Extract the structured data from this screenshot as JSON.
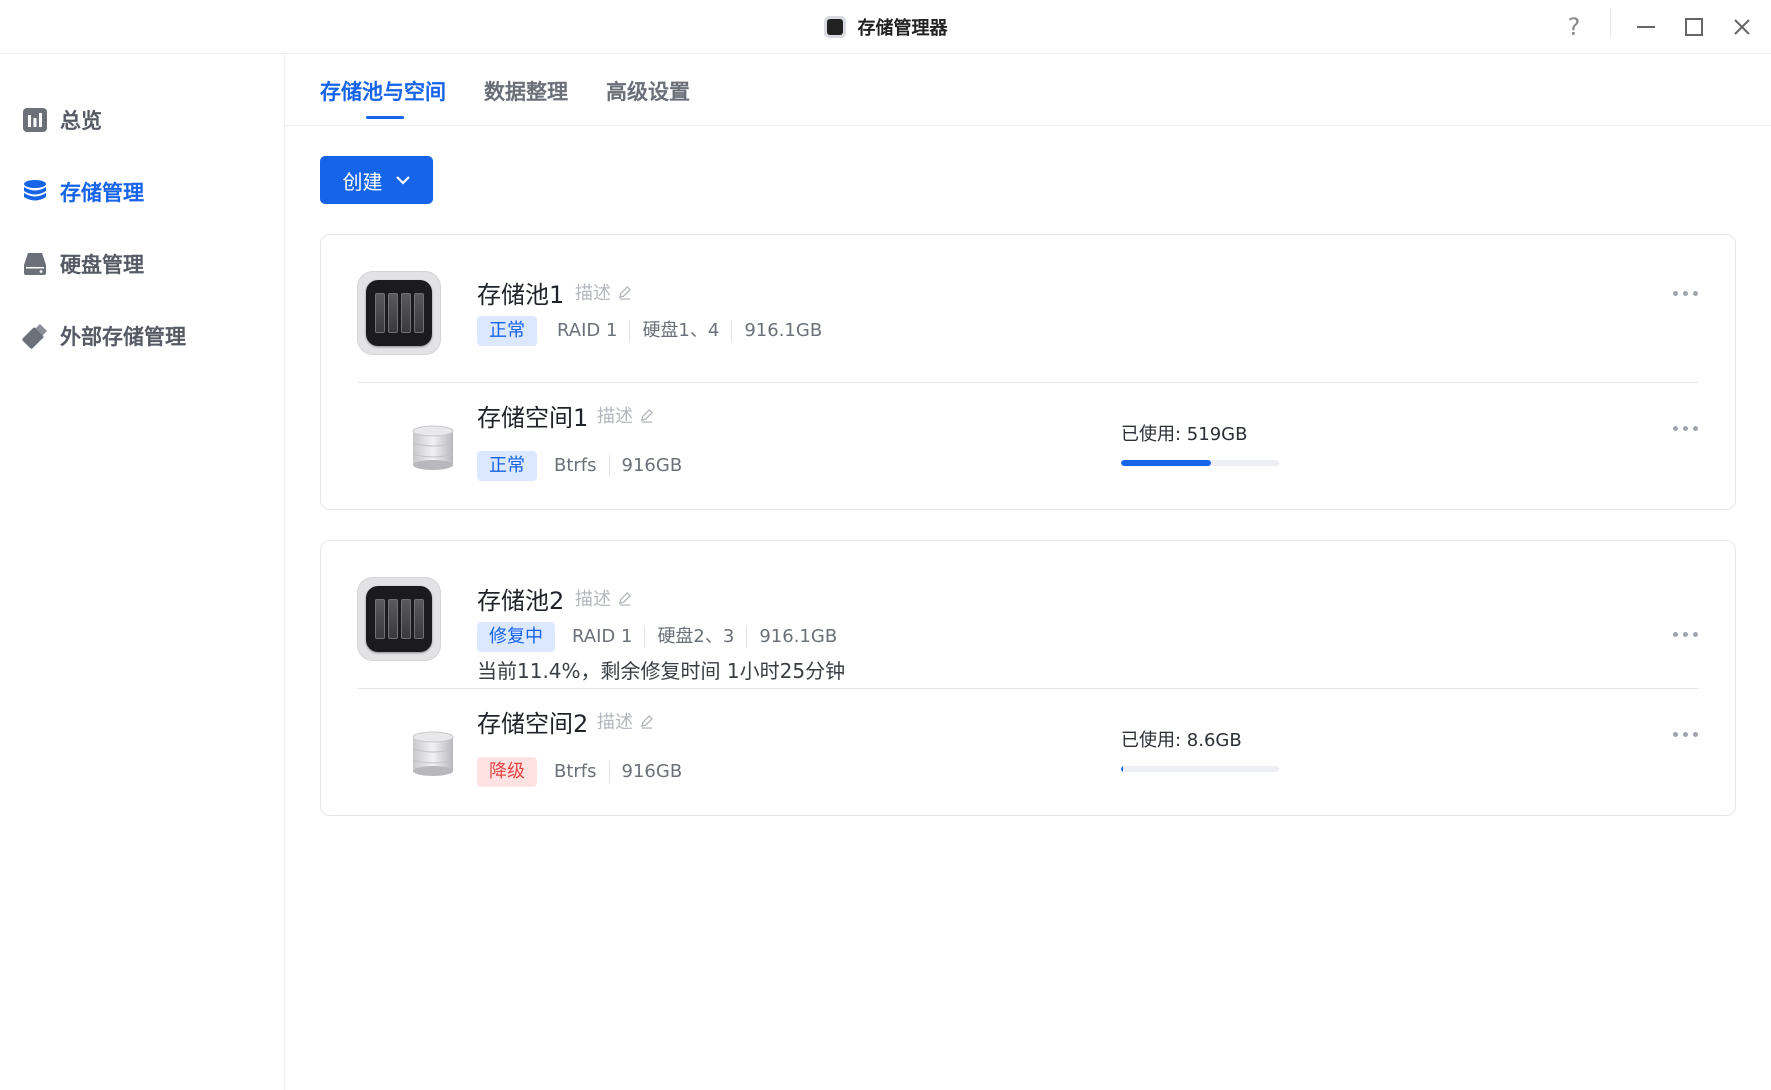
{
  "window": {
    "title": "存储管理器",
    "help_label": "?"
  },
  "sidebar": {
    "items": [
      {
        "label": "总览",
        "icon": "chart-icon",
        "active": false
      },
      {
        "label": "存储管理",
        "icon": "database-icon",
        "active": true
      },
      {
        "label": "硬盘管理",
        "icon": "harddisk-icon",
        "active": false
      },
      {
        "label": "外部存储管理",
        "icon": "usb-drive-icon",
        "active": false
      }
    ]
  },
  "tabs": [
    {
      "label": "存储池与空间",
      "active": true
    },
    {
      "label": "数据整理",
      "active": false
    },
    {
      "label": "高级设置",
      "active": false
    }
  ],
  "toolbar": {
    "create_label": "创建"
  },
  "pools": [
    {
      "name": "存储池1",
      "desc_label": "描述",
      "status": "正常",
      "raid": "RAID 1",
      "disks": "硬盘1、4",
      "capacity": "916.1GB",
      "repair_text": "",
      "space": {
        "name": "存储空间1",
        "desc_label": "描述",
        "status": "正常",
        "fs": "Btrfs",
        "size": "916GB",
        "used_label": "已使用: 519GB",
        "used_fraction": 0.567
      }
    },
    {
      "name": "存储池2",
      "desc_label": "描述",
      "status": "修复中",
      "raid": "RAID 1",
      "disks": "硬盘2、3",
      "capacity": "916.1GB",
      "repair_text": "当前11.4%，剩余修复时间 1小时25分钟",
      "space": {
        "name": "存储空间2",
        "desc_label": "描述",
        "status": "降级",
        "fs": "Btrfs",
        "size": "916GB",
        "used_label": "已使用: 8.6GB",
        "used_fraction": 0.0094
      }
    }
  ],
  "colors": {
    "accent": "#1664e8",
    "warning": "#e54545",
    "badge_ok_bg": "#dbe8ff",
    "badge_warn_bg": "#ffe3e3"
  }
}
